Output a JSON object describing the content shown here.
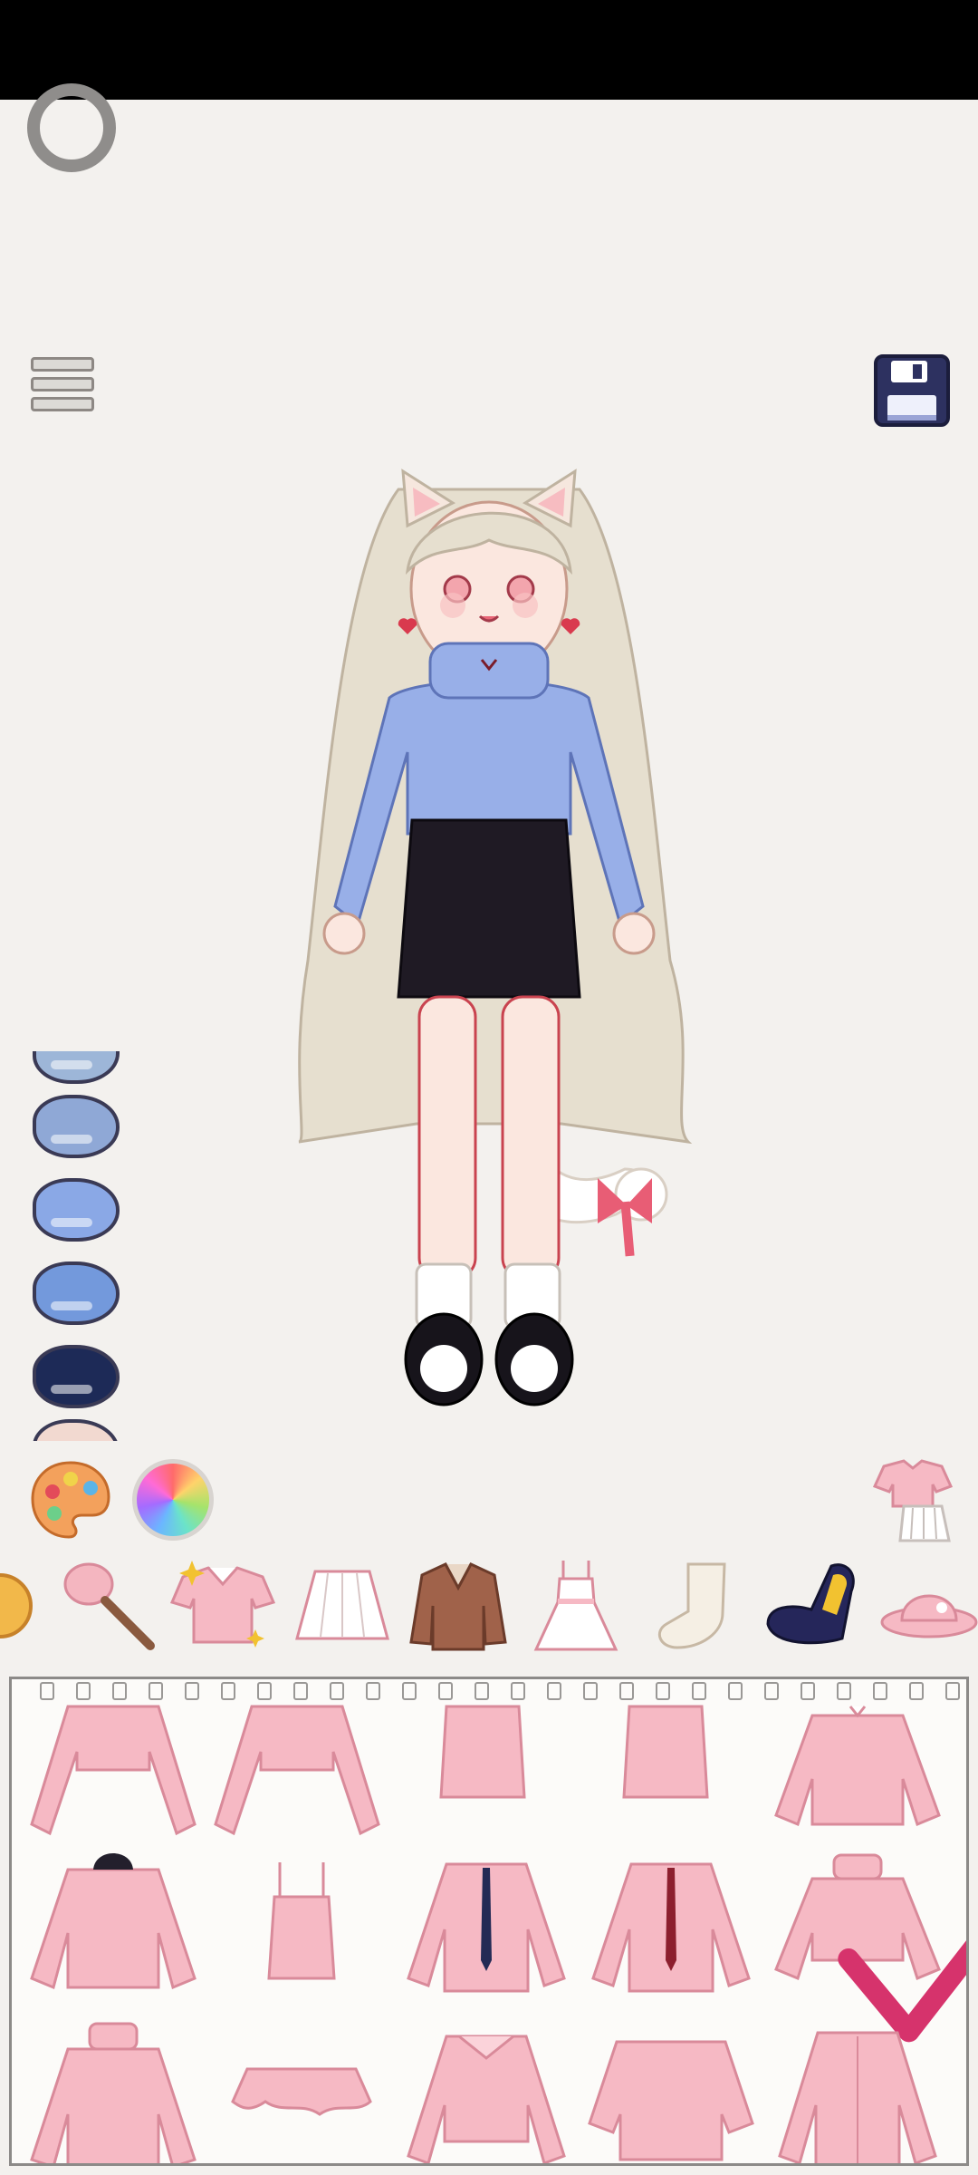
{
  "app": {
    "title": ""
  },
  "colors": {
    "background": "#f3f1ee",
    "item_pink": "#f6b9c4",
    "item_outline": "#d98a9a",
    "selected_check": "#d6336c",
    "save_icon": "#2d3160"
  },
  "icons": {
    "loading": "loading-ring-icon",
    "menu": "menu-icon",
    "save": "floppy-disk-icon",
    "palette": "palette-icon",
    "color_wheel": "color-wheel-icon",
    "outfit": "outfit-preview-icon"
  },
  "swatches": [
    {
      "color": "#9db6d8"
    },
    {
      "color": "#8fa8d6"
    },
    {
      "color": "#8aa8e6"
    },
    {
      "color": "#7399dc"
    },
    {
      "color": "#1d2a57"
    },
    {
      "color": "#f2d9d0"
    }
  ],
  "categories": [
    {
      "name": "accessory-circle",
      "icon": "orb-icon"
    },
    {
      "name": "makeup",
      "icon": "makeup-brush-icon"
    },
    {
      "name": "tops",
      "icon": "shirt-icon",
      "selected": true
    },
    {
      "name": "skirts",
      "icon": "skirt-icon"
    },
    {
      "name": "jackets",
      "icon": "jacket-icon"
    },
    {
      "name": "dresses",
      "icon": "dress-icon"
    },
    {
      "name": "socks",
      "icon": "sock-icon"
    },
    {
      "name": "shoes",
      "icon": "shoe-icon"
    },
    {
      "name": "hats",
      "icon": "hat-icon"
    }
  ],
  "items": [
    {
      "type": "long-sleeve-crop"
    },
    {
      "type": "long-sleeve-crop"
    },
    {
      "type": "tube-top"
    },
    {
      "type": "tube-top"
    },
    {
      "type": "bow-sweater"
    },
    {
      "type": "hoodie"
    },
    {
      "type": "camisole"
    },
    {
      "type": "shirt-navy-tie"
    },
    {
      "type": "shirt-red-tie"
    },
    {
      "type": "turtleneck-crop",
      "selected": true
    },
    {
      "type": "turtleneck-sweater"
    },
    {
      "type": "ruffle-crop"
    },
    {
      "type": "collar-blouse"
    },
    {
      "type": "wide-tee"
    },
    {
      "type": "button-shirt"
    }
  ]
}
